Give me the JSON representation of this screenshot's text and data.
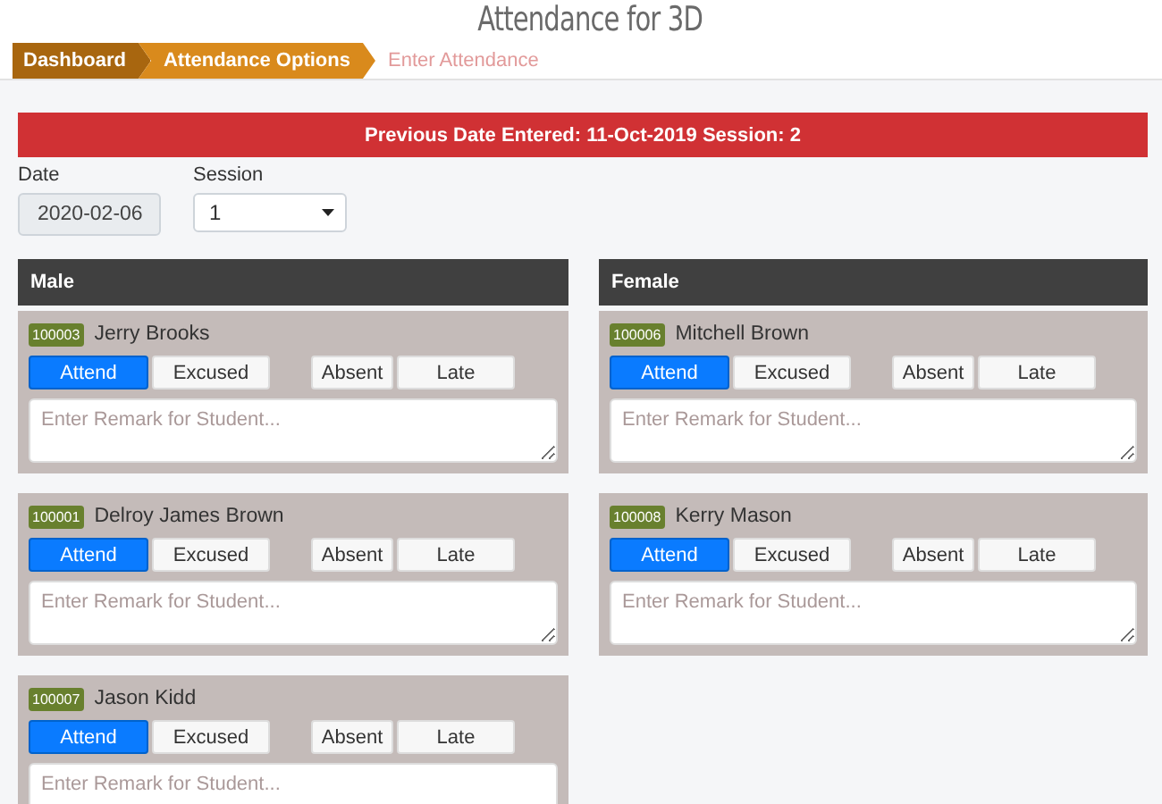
{
  "title": "Attendance for 3D",
  "breadcrumb": [
    {
      "label": "Dashboard",
      "kind": "past"
    },
    {
      "label": "Attendance Options",
      "kind": "past"
    },
    {
      "label": "Enter Attendance",
      "kind": "current"
    }
  ],
  "alert": "Previous Date Entered: 11-Oct-2019 Session: 2",
  "date": {
    "label": "Date",
    "value": "2020-02-06"
  },
  "session": {
    "label": "Session",
    "value": "1"
  },
  "groups": [
    {
      "title": "Male",
      "students": [
        {
          "id": "100003",
          "name": "Jerry Brooks",
          "options": [
            {
              "label": "Attend",
              "selected": true
            },
            {
              "label": "Excused",
              "selected": false
            },
            {
              "label": "Absent",
              "selected": false
            },
            {
              "label": "Late",
              "selected": false
            }
          ],
          "placeholder": "Enter Remark for Student..."
        },
        {
          "id": "100001",
          "name": "Delroy James Brown",
          "options": [
            {
              "label": "Attend",
              "selected": true
            },
            {
              "label": "Excused",
              "selected": false
            },
            {
              "label": "Absent",
              "selected": false
            },
            {
              "label": "Late",
              "selected": false
            }
          ],
          "placeholder": "Enter Remark for Student..."
        },
        {
          "id": "100007",
          "name": "Jason Kidd",
          "options": [
            {
              "label": "Attend",
              "selected": true
            },
            {
              "label": "Excused",
              "selected": false
            },
            {
              "label": "Absent",
              "selected": false
            },
            {
              "label": "Late",
              "selected": false
            }
          ],
          "placeholder": "Enter Remark for Student..."
        }
      ]
    },
    {
      "title": "Female",
      "students": [
        {
          "id": "100006",
          "name": "Mitchell Brown",
          "options": [
            {
              "label": "Attend",
              "selected": true
            },
            {
              "label": "Excused",
              "selected": false
            },
            {
              "label": "Absent",
              "selected": false
            },
            {
              "label": "Late",
              "selected": false
            }
          ],
          "placeholder": "Enter Remark for Student..."
        },
        {
          "id": "100008",
          "name": "Kerry Mason",
          "options": [
            {
              "label": "Attend",
              "selected": true
            },
            {
              "label": "Excused",
              "selected": false
            },
            {
              "label": "Absent",
              "selected": false
            },
            {
              "label": "Late",
              "selected": false
            }
          ],
          "placeholder": "Enter Remark for Student..."
        }
      ]
    }
  ]
}
